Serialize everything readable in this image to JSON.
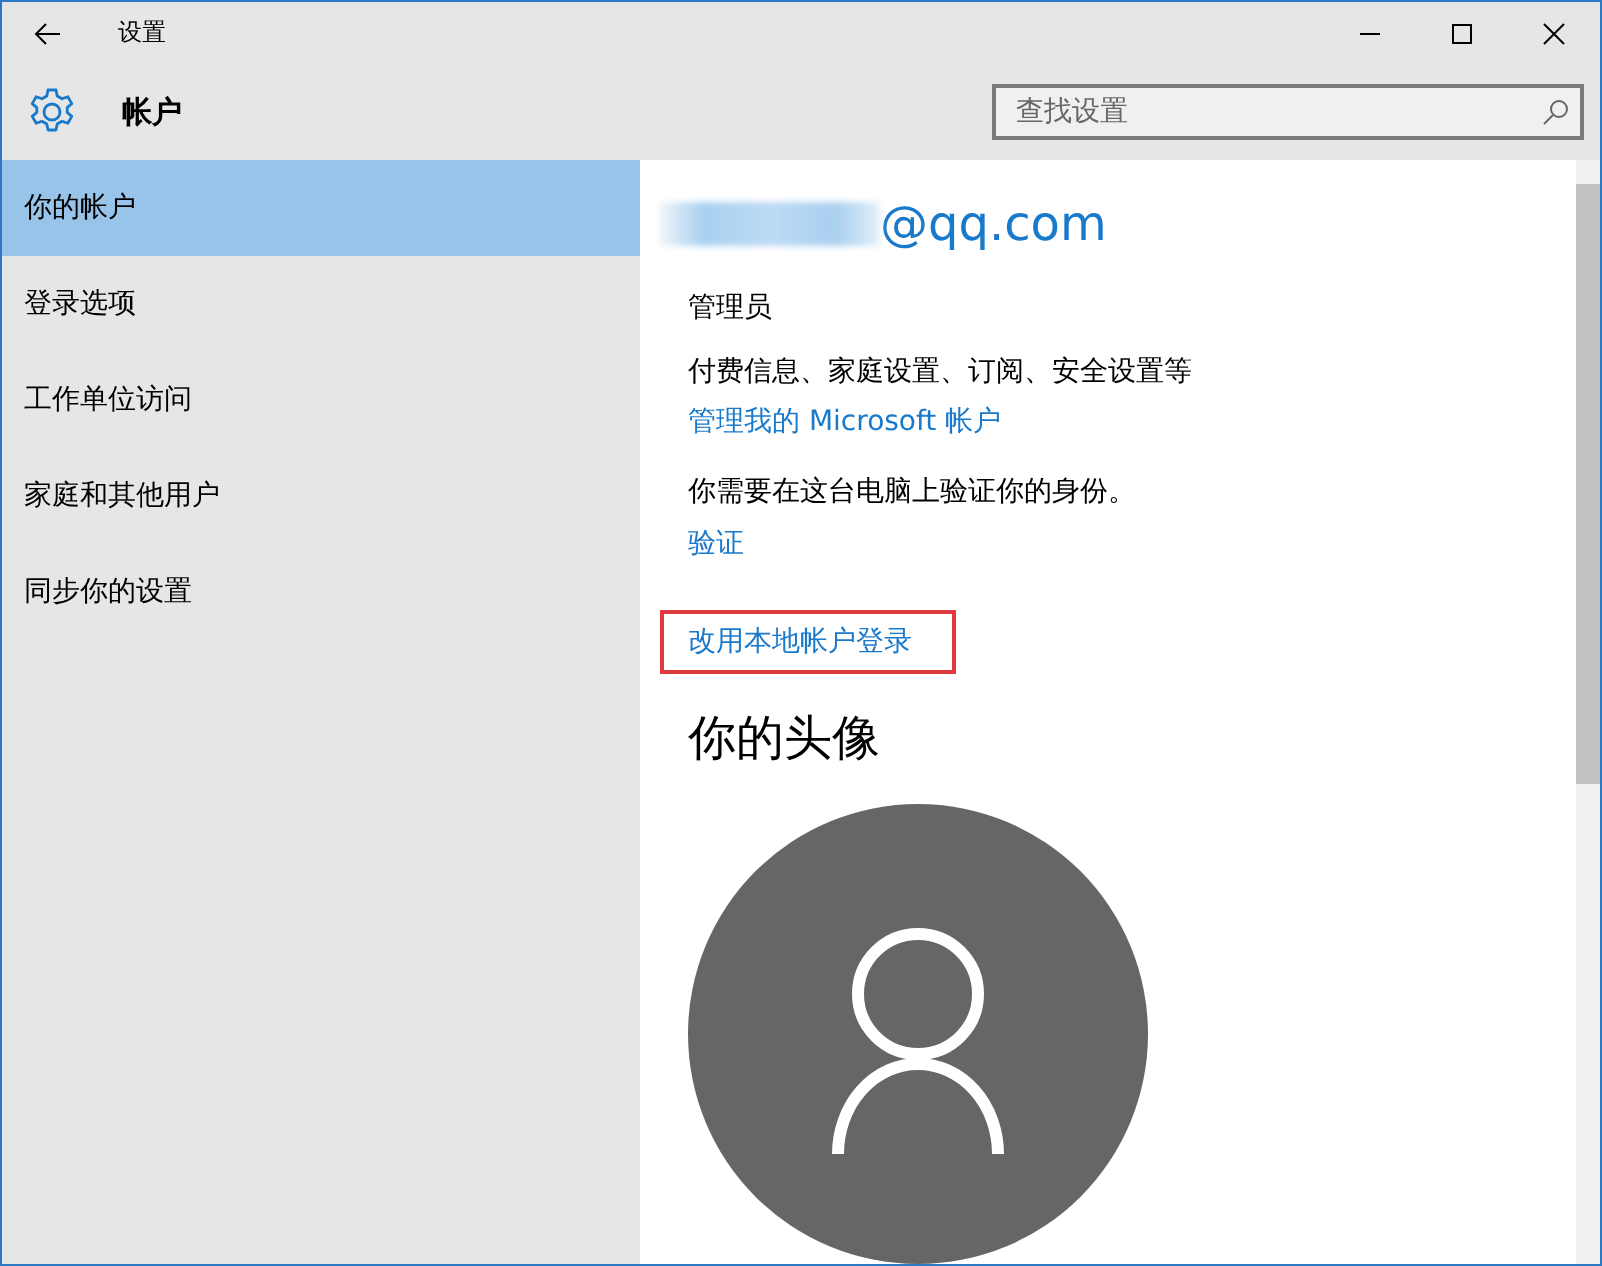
{
  "window": {
    "title": "设置"
  },
  "header": {
    "title": "帐户"
  },
  "search": {
    "placeholder": "查找设置"
  },
  "sidebar": {
    "items": [
      {
        "label": "你的帐户",
        "selected": true
      },
      {
        "label": "登录选项",
        "selected": false
      },
      {
        "label": "工作单位访问",
        "selected": false
      },
      {
        "label": "家庭和其他用户",
        "selected": false
      },
      {
        "label": "同步你的设置",
        "selected": false
      }
    ]
  },
  "account": {
    "email": "@qq.com",
    "email_redacted": true,
    "role": "管理员",
    "description": "付费信息、家庭设置、订阅、安全设置等",
    "manage_link": "管理我的 Microsoft 帐户",
    "verify_text": "你需要在这台电脑上验证你的身份。",
    "verify_link": "验证",
    "local_link": {
      "label": "改用本地帐户登录",
      "highlighted": true
    }
  },
  "avatar": {
    "heading": "你的头像"
  }
}
